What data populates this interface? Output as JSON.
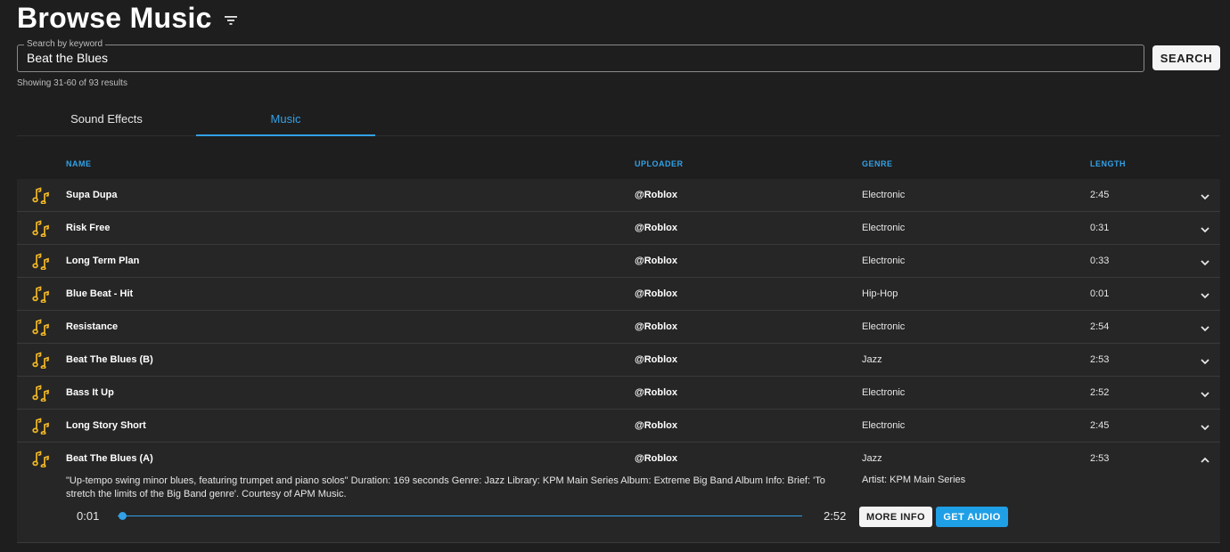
{
  "header": {
    "title": "Browse Music",
    "filter_icon": "filter-icon"
  },
  "search": {
    "label": "Search by keyword",
    "value": "Beat the Blues",
    "button_label": "SEARCH"
  },
  "results_text": "Showing 31-60 of 93 results",
  "tabs": [
    {
      "label": "Sound Effects",
      "active": false
    },
    {
      "label": "Music",
      "active": true
    }
  ],
  "colors": {
    "accent": "#33a1e6",
    "note_icon": "#f2b824",
    "background": "#1e1e1e",
    "row": "#262626"
  },
  "table": {
    "headers": {
      "name": "NAME",
      "uploader": "UPLOADER",
      "genre": "GENRE",
      "length": "LENGTH"
    },
    "rows": [
      {
        "name": "Supa Dupa",
        "uploader": "@Roblox",
        "genre": "Electronic",
        "length": "2:45"
      },
      {
        "name": "Risk Free",
        "uploader": "@Roblox",
        "genre": "Electronic",
        "length": "0:31"
      },
      {
        "name": "Long Term Plan",
        "uploader": "@Roblox",
        "genre": "Electronic",
        "length": "0:33"
      },
      {
        "name": "Blue Beat - Hit",
        "uploader": "@Roblox",
        "genre": "Hip-Hop",
        "length": "0:01"
      },
      {
        "name": "Resistance",
        "uploader": "@Roblox",
        "genre": "Electronic",
        "length": "2:54"
      },
      {
        "name": "Beat The Blues (B)",
        "uploader": "@Roblox",
        "genre": "Jazz",
        "length": "2:53"
      },
      {
        "name": "Bass It Up",
        "uploader": "@Roblox",
        "genre": "Electronic",
        "length": "2:52"
      },
      {
        "name": "Long Story Short",
        "uploader": "@Roblox",
        "genre": "Electronic",
        "length": "2:45"
      }
    ],
    "expanded_row": {
      "name": "Beat The Blues (A)",
      "uploader": "@Roblox",
      "genre": "Jazz",
      "length": "2:53",
      "description": "\"Up-tempo swing minor blues, featuring trumpet and piano solos\" Duration: 169 seconds  Genre: Jazz Library: KPM Main Series Album: Extreme Big Band Album Info: Brief: 'To stretch the limits of the Big Band genre'.  Courtesy of APM Music.",
      "artist": "Artist: KPM Main Series",
      "current_time": "0:01",
      "total_time": "2:52",
      "progress": 0.006,
      "more_info_label": "MORE INFO",
      "get_audio_label": "GET AUDIO"
    }
  }
}
